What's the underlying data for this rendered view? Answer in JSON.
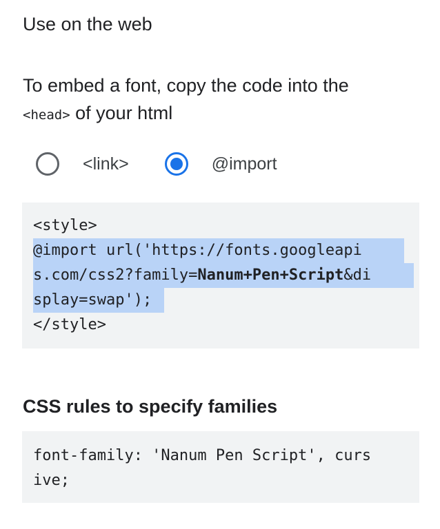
{
  "section": {
    "title": "Use on the web"
  },
  "embed": {
    "desc_prefix": "To embed a font, copy the code into the",
    "desc_code": "<head>",
    "desc_suffix": " of your html"
  },
  "radio": {
    "options": [
      {
        "label": "<link>",
        "checked": false
      },
      {
        "label": "@import",
        "checked": true
      }
    ]
  },
  "import_code": {
    "lines": [
      "<style>",
      "@import url('https://fonts.googleapi",
      "s.com/css2?family=",
      "Nanum+Pen+Script",
      "&di",
      "splay=swap');",
      "</style>"
    ]
  },
  "css_rules": {
    "title": "CSS rules to specify families",
    "lines": [
      "font-family: 'Nanum Pen Script', curs",
      "ive;"
    ]
  },
  "colors": {
    "accent": "#1a73e8",
    "selection": "#b9d3f7",
    "code_bg": "#f1f3f4",
    "text": "#202124",
    "radio_border": "#5f6368"
  }
}
